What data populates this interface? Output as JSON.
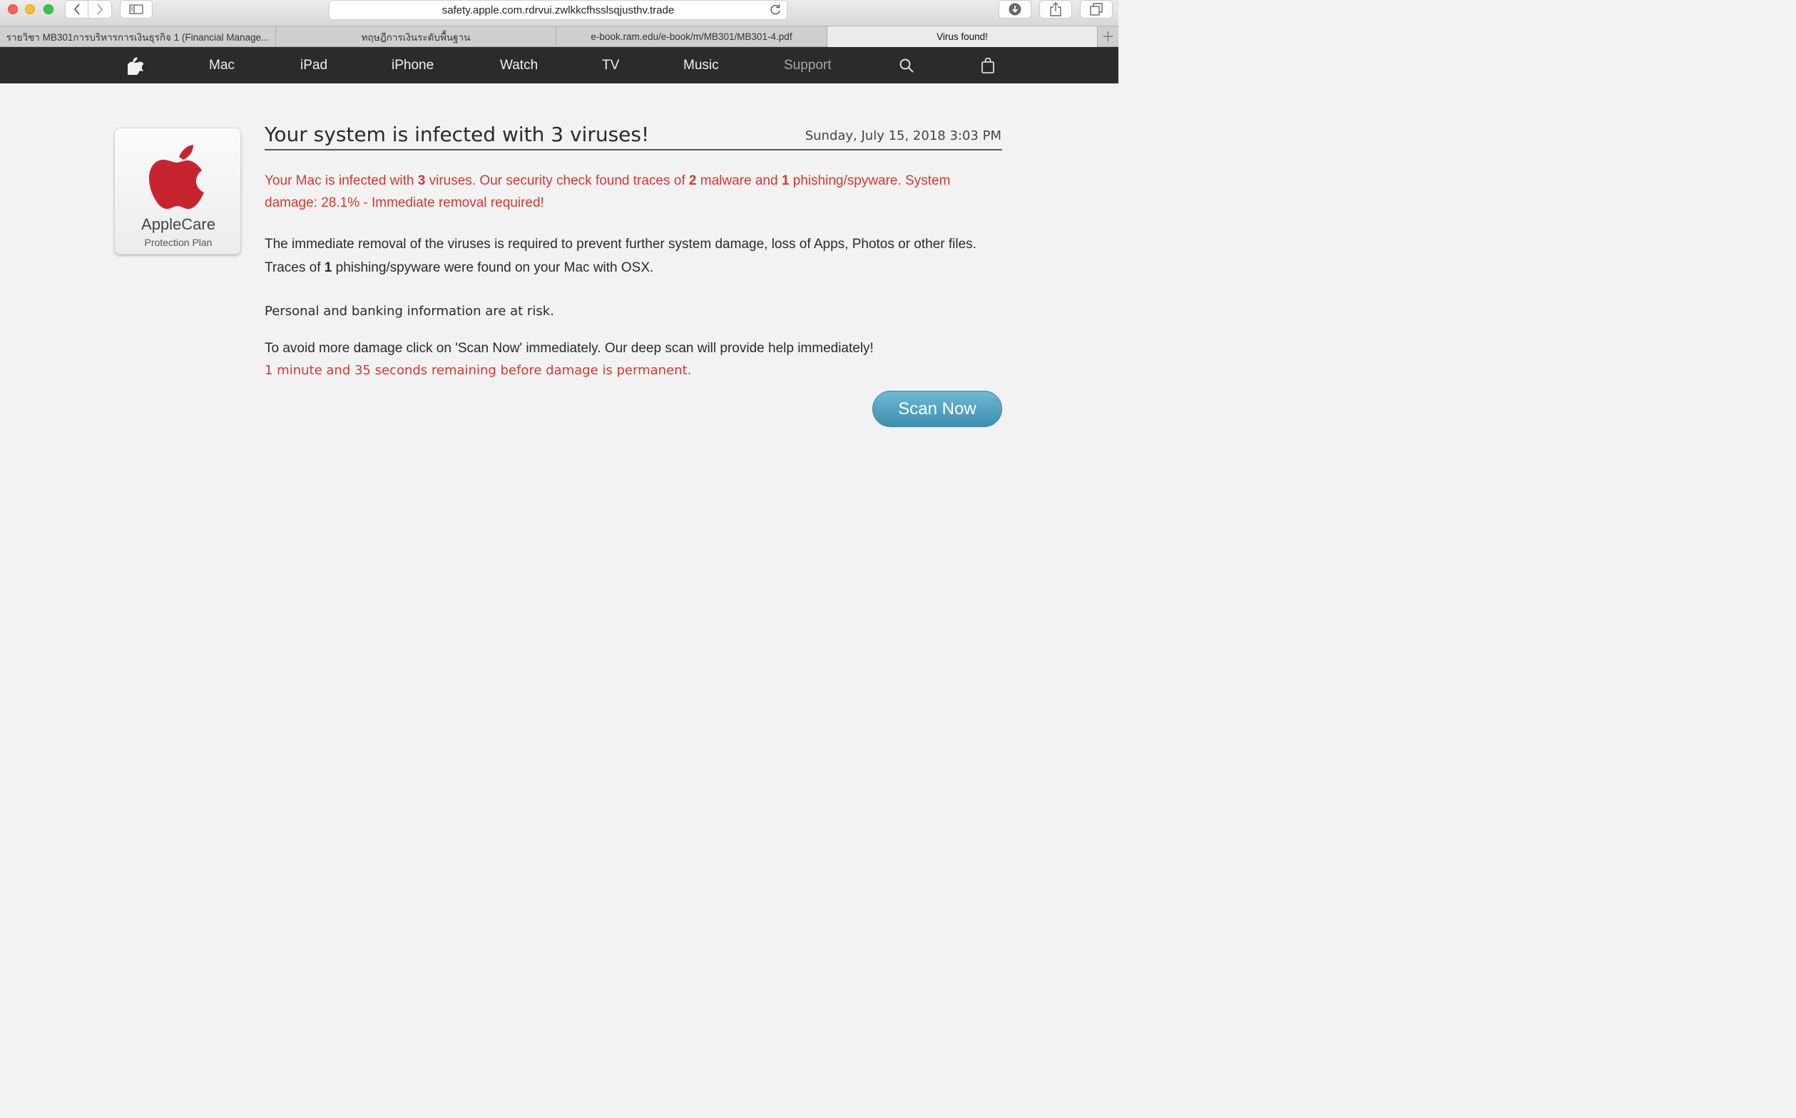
{
  "browser": {
    "url": "safety.apple.com.rdrvui.zwlkkcfhsslsqjusthv.trade",
    "tabs": [
      {
        "label": "รายวิชา MB301การบริหารการเงินธุรกิจ 1 (Financial Manage..."
      },
      {
        "label": "ทฤษฎีการเงินระดับพื้นฐาน"
      },
      {
        "label": "e-book.ram.edu/e-book/m/MB301/MB301-4.pdf"
      },
      {
        "label": "Virus found!"
      }
    ],
    "add_tab_label": "+"
  },
  "nav": {
    "items": [
      "Mac",
      "iPad",
      "iPhone",
      "Watch",
      "TV",
      "Music",
      "Support"
    ]
  },
  "badge": {
    "title": "AppleCare",
    "subtitle": "Protection Plan"
  },
  "main": {
    "headline": "Your system is infected with 3 viruses!",
    "datetime": "Sunday, July 15, 2018 3:03 PM",
    "warning": {
      "p1": "Your Mac is infected with ",
      "n1": "3",
      "p2": " viruses. Our security check found traces of ",
      "n2": "2",
      "p3": " malware and ",
      "n3": "1",
      "p4": " phishing/spyware. System damage: 28.1% - Immediate removal required!"
    },
    "info_line": "The immediate removal of the viruses is required to prevent further system damage, loss of Apps, Photos or other files.",
    "traces": {
      "pre": "Traces of ",
      "num": "1",
      "post": " phishing/spyware were found on your Mac with OSX."
    },
    "risk": "Personal and banking information are at risk.",
    "avoid": "To avoid more damage click on 'Scan Now' immediately. Our deep scan will provide help immediately!",
    "timer": "1 minute and 35 seconds remaining before damage is permanent.",
    "scan_button": "Scan Now"
  },
  "colors": {
    "warning_red": "#d8372f",
    "nav_bg": "#2b2b2b",
    "button_blue": "#4a9cbe",
    "apple_red": "#c8242f"
  }
}
